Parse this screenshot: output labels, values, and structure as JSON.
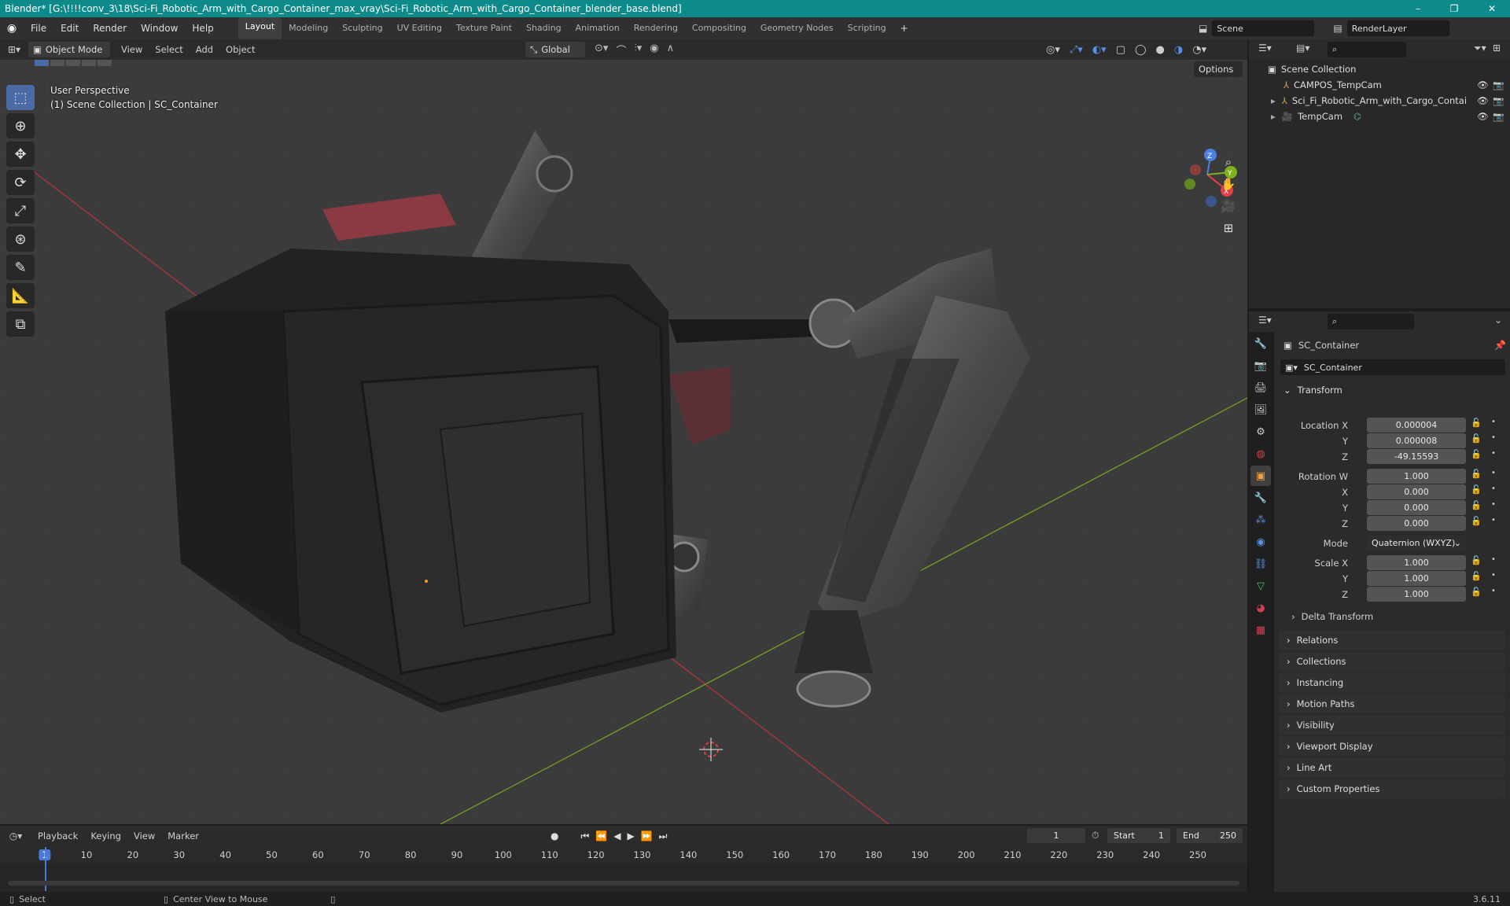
{
  "window": {
    "title": "Blender* [G:\\!!!!conv_3\\18\\Sci-Fi_Robotic_Arm_with_Cargo_Container_max_vray\\Sci-Fi_Robotic_Arm_with_Cargo_Container_blender_base.blend]",
    "minimize": "–",
    "maximize": "❐",
    "close": "✕"
  },
  "menus": [
    "File",
    "Edit",
    "Render",
    "Window",
    "Help"
  ],
  "workspaces": [
    "Layout",
    "Modeling",
    "Sculpting",
    "UV Editing",
    "Texture Paint",
    "Shading",
    "Animation",
    "Rendering",
    "Compositing",
    "Geometry Nodes",
    "Scripting"
  ],
  "add_workspace": "+",
  "scene": {
    "name": "Scene",
    "render_layer": "RenderLayer"
  },
  "viewport_header": {
    "mode": "Object Mode",
    "items": [
      "View",
      "Select",
      "Add",
      "Object"
    ],
    "orientation": "Global",
    "options": "Options"
  },
  "viewport": {
    "perspective": "User Perspective",
    "collection": "(1) Scene Collection | SC_Container",
    "gizmo_axes": {
      "x": "X",
      "y": "Y",
      "z": "Z"
    }
  },
  "outliner": {
    "root": "Scene Collection",
    "items": [
      {
        "name": "CAMPOS_TempCam"
      },
      {
        "name": "Sci_Fi_Robotic_Arm_with_Cargo_Contai"
      },
      {
        "name": "TempCam"
      }
    ]
  },
  "properties": {
    "object_name": "SC_Container",
    "data_name": "SC_Container",
    "transform_label": "Transform",
    "location": {
      "label": "Location X",
      "x": "0.000004",
      "y": "0.000008",
      "z": "-49.15593"
    },
    "rotation": {
      "label": "Rotation W",
      "w": "1.000",
      "x": "0.000",
      "y": "0.000",
      "z": "0.000"
    },
    "axis_labels": {
      "x": "X",
      "y": "Y",
      "z": "Z"
    },
    "mode_label": "Mode",
    "mode_value": "Quaternion (WXYZ)",
    "scale": {
      "label": "Scale X",
      "x": "1.000",
      "y": "1.000",
      "z": "1.000"
    },
    "delta": "Delta Transform",
    "panels": [
      "Relations",
      "Collections",
      "Instancing",
      "Motion Paths",
      "Visibility",
      "Viewport Display",
      "Line Art",
      "Custom Properties"
    ]
  },
  "timeline": {
    "menus": [
      "Playback",
      "Keying",
      "View",
      "Marker"
    ],
    "current_frame": "1",
    "start_label": "Start",
    "start": "1",
    "end_label": "End",
    "end": "250",
    "ticks": [
      "1",
      "10",
      "20",
      "30",
      "40",
      "50",
      "60",
      "70",
      "80",
      "90",
      "100",
      "110",
      "120",
      "130",
      "140",
      "150",
      "160",
      "170",
      "180",
      "190",
      "200",
      "210",
      "220",
      "230",
      "240",
      "250"
    ]
  },
  "status": {
    "select": "Select",
    "center": "Center View to Mouse",
    "version": "3.6.11"
  }
}
